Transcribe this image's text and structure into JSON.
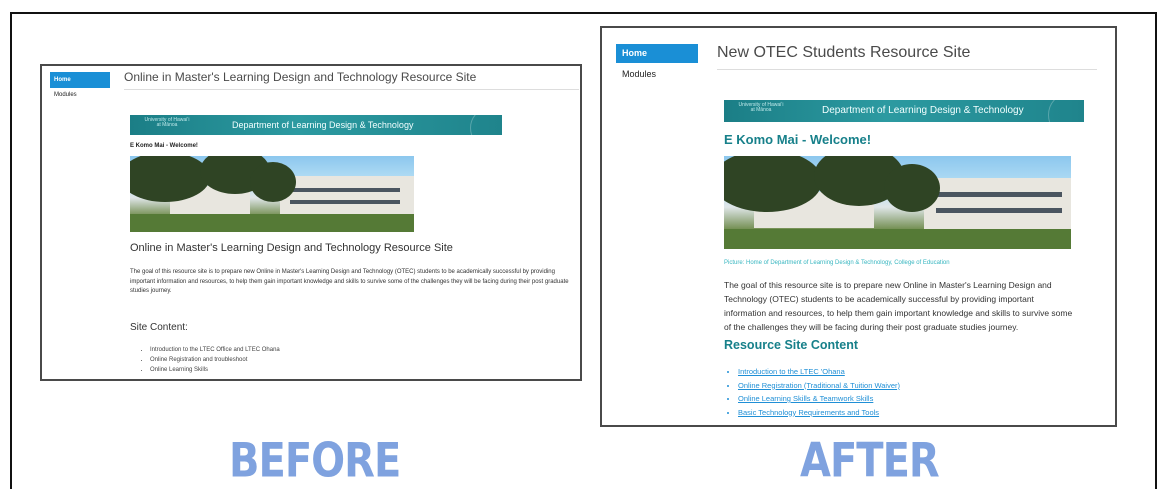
{
  "labels": {
    "before": "BEFORE",
    "after": "AFTER"
  },
  "before": {
    "nav": {
      "home": "Home",
      "modules": "Modules"
    },
    "page_title": "Online in Master's Learning Design and Technology Resource Site",
    "banner": {
      "university": "University of Hawaiʻi at Mānoa",
      "department": "Department of Learning Design & Technology"
    },
    "greeting": "E Komo Mai - Welcome!",
    "subheading": "Online in Master's Learning Design and Technology Resource Site",
    "body": "The goal of this resource site is to prepare new Online in Master's Learning Design and Technology (OTEC) students to be academically successful by providing important information and resources, to help them gain important knowledge and skills to survive some of the challenges they will be facing during their post graduate studies journey.",
    "section_heading": "Site Content:",
    "links": [
      "Introduction to the LTEC Office and LTEC Ohana",
      "Online Registration and troubleshoot",
      "Online Learning Skills"
    ]
  },
  "after": {
    "nav": {
      "home": "Home",
      "modules": "Modules"
    },
    "page_title": "New OTEC Students Resource Site",
    "banner": {
      "university": "University of Hawaiʻi at Mānoa",
      "department": "Department of Learning Design & Technology"
    },
    "greeting": "E Komo Mai - Welcome!",
    "caption": "Picture: Home of Department of Learning Design & Technology, College of Education",
    "body": "The goal of this resource site is to prepare new Online in Master's Learning Design and Technology (OTEC) students to be academically successful by providing important information and resources, to help them gain important knowledge and skills to survive some of the challenges they will be facing during their post graduate studies journey.",
    "section_heading": "Resource Site Content",
    "links": [
      "Introduction to the LTEC 'Ohana",
      "Online Registration (Traditional & Tuition Waiver)",
      "Online Learning Skills & Teamwork Skills",
      "Basic Technology Requirements and Tools"
    ]
  },
  "colors": {
    "nav_active": "#1a8fd6",
    "accent_teal": "#17808a",
    "label_blue": "#7fa2df",
    "link": "#1f8fd6"
  }
}
